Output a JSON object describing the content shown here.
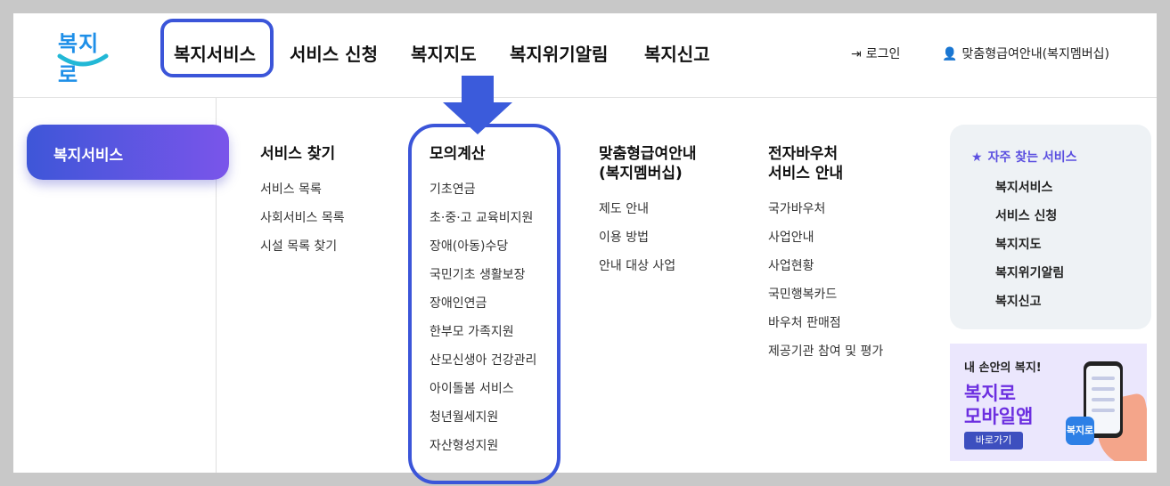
{
  "logo": {
    "text": "복지로"
  },
  "gnb": [
    {
      "label": "복지서비스"
    },
    {
      "label": "서비스 신청"
    },
    {
      "label": "복지지도"
    },
    {
      "label": "복지위기알림"
    },
    {
      "label": "복지신고"
    }
  ],
  "util": {
    "login": "로그인",
    "benefit": "맞춤형급여안내(복지멤버십)"
  },
  "side": {
    "active": "복지서비스"
  },
  "columns": [
    {
      "title": "서비스 찾기",
      "items": [
        "서비스 목록",
        "사회서비스 목록",
        "시설 목록 찾기"
      ]
    },
    {
      "title": "모의계산",
      "items": [
        "기초연금",
        "초·중·고 교육비지원",
        "장애(아동)수당",
        "국민기초 생활보장",
        "장애인연금",
        "한부모 가족지원",
        "산모신생아 건강관리",
        "아이돌봄 서비스",
        "청년월세지원",
        "자산형성지원"
      ]
    },
    {
      "title": "맞춤형급여안내\n(복지멤버십)",
      "items": [
        "제도 안내",
        "이용 방법",
        "안내 대상 사업"
      ]
    },
    {
      "title": "전자바우처\n서비스 안내",
      "items": [
        "국가바우처",
        "사업안내",
        "사업현황",
        "국민행복카드",
        "바우처 판매점",
        "제공기관 참여 및 평가"
      ]
    }
  ],
  "favorites": {
    "title": "자주 찾는 서비스",
    "items": [
      "복지서비스",
      "서비스 신청",
      "복지지도",
      "복지위기알림",
      "복지신고"
    ]
  },
  "banner": {
    "subtitle": "내 손안의 복지!",
    "line1": "복지로",
    "line2": "모바일앱",
    "button": "바로가기",
    "icon_text": "복지로"
  },
  "colors": {
    "accent": "#3b55d9",
    "pill_start": "#3e56d8",
    "pill_end": "#7a55ea",
    "fav_title": "#5b4fe0",
    "banner_text": "#6c2fe0"
  }
}
